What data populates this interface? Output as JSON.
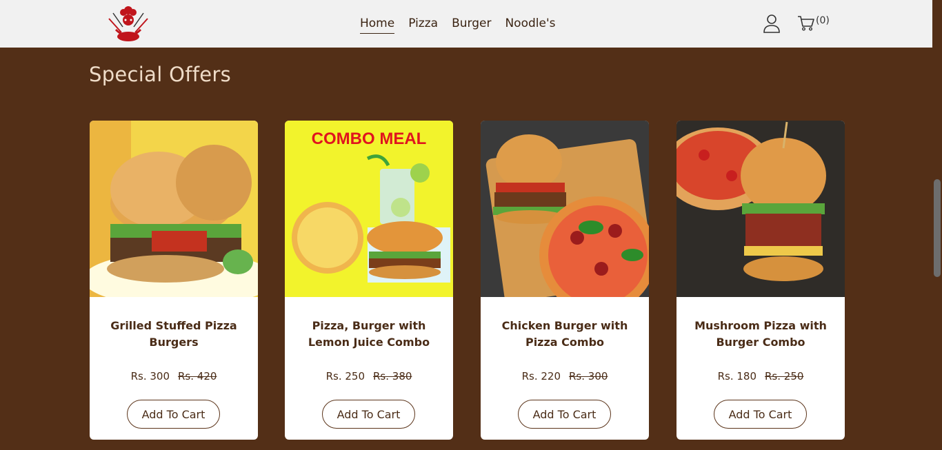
{
  "header": {
    "nav": [
      {
        "label": "Home",
        "active": true
      },
      {
        "label": "Pizza",
        "active": false
      },
      {
        "label": "Burger",
        "active": false
      },
      {
        "label": "Noodle's",
        "active": false
      }
    ],
    "cart_count": "(0)"
  },
  "section": {
    "title": "Special Offers"
  },
  "offers": [
    {
      "name": "Grilled Stuffed Pizza Burgers",
      "price": "Rs. 300",
      "old_price": "Rs. 420",
      "button": "Add To Cart"
    },
    {
      "name": "Pizza, Burger with Lemon Juice Combo",
      "price": "Rs. 250",
      "old_price": "Rs. 380",
      "button": "Add To Cart",
      "image_text": "COMBO MEAL"
    },
    {
      "name": "Chicken Burger with Pizza Combo",
      "price": "Rs. 220",
      "old_price": "Rs. 300",
      "button": "Add To Cart"
    },
    {
      "name": "Mushroom Pizza with Burger Combo",
      "price": "Rs. 180",
      "old_price": "Rs. 250",
      "button": "Add To Cart"
    }
  ],
  "colors": {
    "page_bg": "#532f17",
    "header_bg": "#f1f1f1",
    "title": "#efdcc8",
    "text": "#4a2c17",
    "combo_text": "#e0141e",
    "combo_bg": "#f2f32c"
  }
}
